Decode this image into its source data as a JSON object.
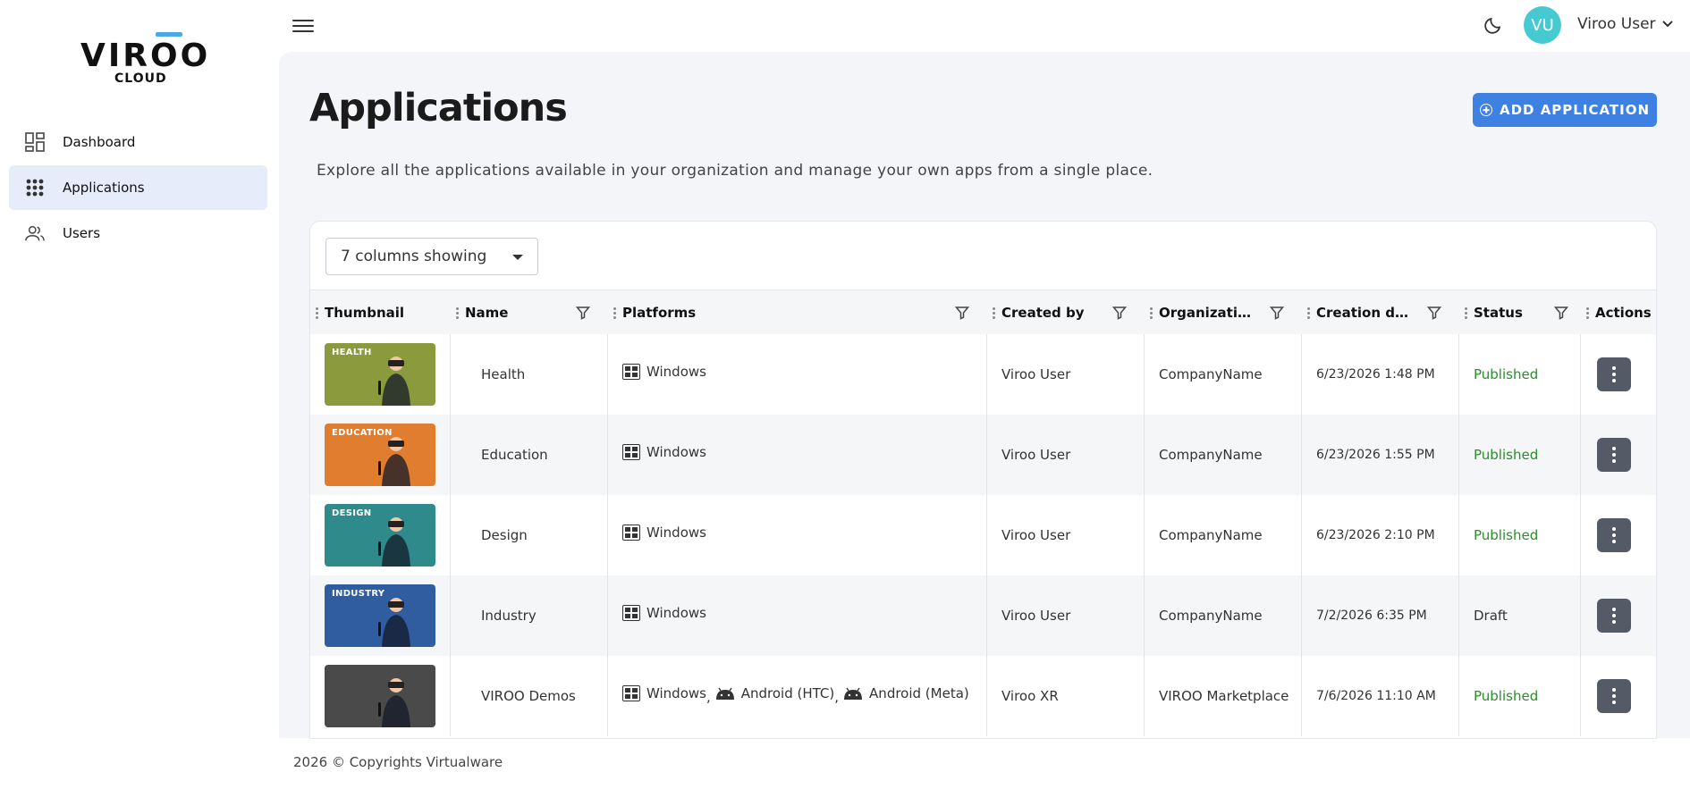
{
  "brand": {
    "name": "VIROO",
    "sub": "CLOUD"
  },
  "sidebar": {
    "items": [
      {
        "label": "Dashboard",
        "icon": "dashboard-icon",
        "active": false
      },
      {
        "label": "Applications",
        "icon": "apps-grid-icon",
        "active": true
      },
      {
        "label": "Users",
        "icon": "users-icon",
        "active": false
      }
    ]
  },
  "topbar": {
    "avatar_initials": "VU",
    "user_name": "Viroo User"
  },
  "page": {
    "title": "Applications",
    "add_button": "ADD APPLICATION",
    "subtitle": "Explore all the applications available in your organization and manage your own apps from a single place."
  },
  "table": {
    "columns_select": "7 columns showing",
    "headers": [
      "Thumbnail",
      "Name",
      "Platforms",
      "Created by",
      "Organizati…",
      "Creation d…",
      "Status",
      "Actions"
    ],
    "rows": [
      {
        "thumb_label": "HEALTH",
        "thumb_color": "#8b9a3c",
        "name": "Health",
        "platforms": [
          "Windows"
        ],
        "created_by": "Viroo User",
        "organization": "CompanyName",
        "created": "6/23/2026 1:48 PM",
        "status": "Published"
      },
      {
        "thumb_label": "EDUCATION",
        "thumb_color": "#e07d2f",
        "name": "Education",
        "platforms": [
          "Windows"
        ],
        "created_by": "Viroo User",
        "organization": "CompanyName",
        "created": "6/23/2026 1:55 PM",
        "status": "Published"
      },
      {
        "thumb_label": "DESIGN",
        "thumb_color": "#2f8a8c",
        "name": "Design",
        "platforms": [
          "Windows"
        ],
        "created_by": "Viroo User",
        "organization": "CompanyName",
        "created": "6/23/2026 2:10 PM",
        "status": "Published"
      },
      {
        "thumb_label": "INDUSTRY",
        "thumb_color": "#2f5da0",
        "name": "Industry",
        "platforms": [
          "Windows"
        ],
        "created_by": "Viroo User",
        "organization": "CompanyName",
        "created": "7/2/2026 6:35 PM",
        "status": "Draft"
      },
      {
        "thumb_label": "",
        "thumb_color": "#4a4a4a",
        "name": "VIROO Demos",
        "platforms": [
          "Windows",
          "Android (HTC)",
          "Android (Meta)"
        ],
        "created_by": "Viroo XR",
        "organization": "VIROO Marketplace",
        "created": "7/6/2026 11:10 AM",
        "status": "Published"
      }
    ]
  },
  "footer": {
    "text": "2026 © Copyrights Virtualware"
  },
  "colors": {
    "accent": "#3f80e3",
    "published": "#2e8b2e",
    "avatar": "#47c9d1",
    "active_nav": "#e7ecfb"
  }
}
